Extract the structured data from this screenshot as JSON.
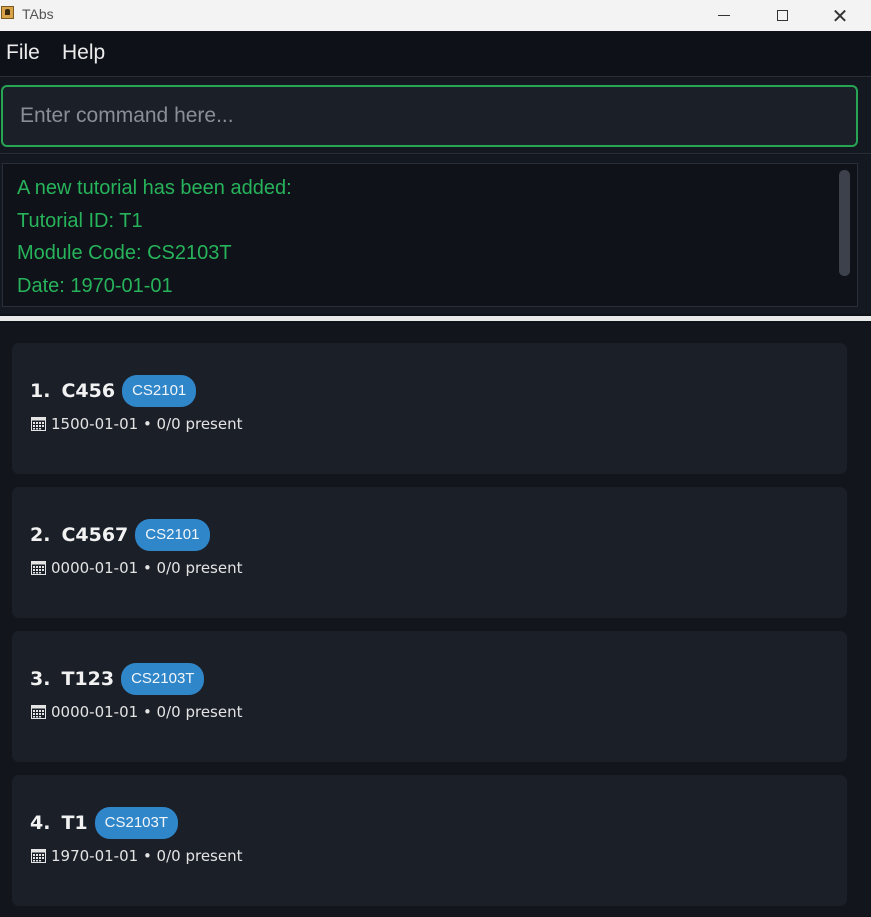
{
  "window": {
    "title": "TAbs"
  },
  "menu": {
    "file": "File",
    "help": "Help"
  },
  "command": {
    "placeholder": "Enter command here...",
    "value": ""
  },
  "result": {
    "lines": [
      "A new tutorial has been added:",
      "Tutorial ID: T1",
      "Module Code: CS2103T",
      "Date: 1970-01-01"
    ]
  },
  "tutorials": [
    {
      "index": "1.",
      "id": "C456",
      "module": "CS2101",
      "meta": "1500-01-01 • 0/0 present"
    },
    {
      "index": "2.",
      "id": "C4567",
      "module": "CS2101",
      "meta": "0000-01-01 • 0/0 present"
    },
    {
      "index": "3.",
      "id": "T123",
      "module": "CS2103T",
      "meta": "0000-01-01 • 0/0 present"
    },
    {
      "index": "4.",
      "id": "T1",
      "module": "CS2103T",
      "meta": "1970-01-01 • 0/0 present"
    }
  ],
  "colors": {
    "accent": "#26a554",
    "result_text": "#27b35b",
    "badge": "#2f86c9",
    "background": "#12151b",
    "card": "#1b1f28"
  }
}
